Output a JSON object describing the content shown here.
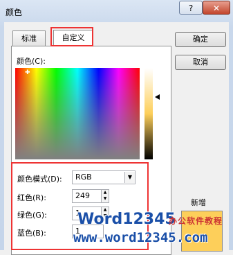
{
  "window": {
    "title": "颜色",
    "help_label": "?",
    "close_label": "✕"
  },
  "tabs": [
    {
      "label": "标准"
    },
    {
      "label": "自定义"
    }
  ],
  "custom": {
    "colors_label": "颜色(C):",
    "color_model_label": "颜色模式(D):",
    "color_model_value": "RGB",
    "red_label": "红色(R):",
    "red_value": "249",
    "green_label": "绿色(G):",
    "green_value": "1",
    "blue_label": "蓝色(B):",
    "blue_value": "1"
  },
  "buttons": {
    "ok": "确定",
    "cancel": "取消"
  },
  "preview": {
    "new_label": "新增",
    "new_color": "#fdcf5a"
  },
  "watermark": {
    "brand": "Word12345",
    "subtitle": "办公软件教程",
    "url": "www.word12345.com"
  },
  "highlights": {
    "color": "#e33333"
  }
}
